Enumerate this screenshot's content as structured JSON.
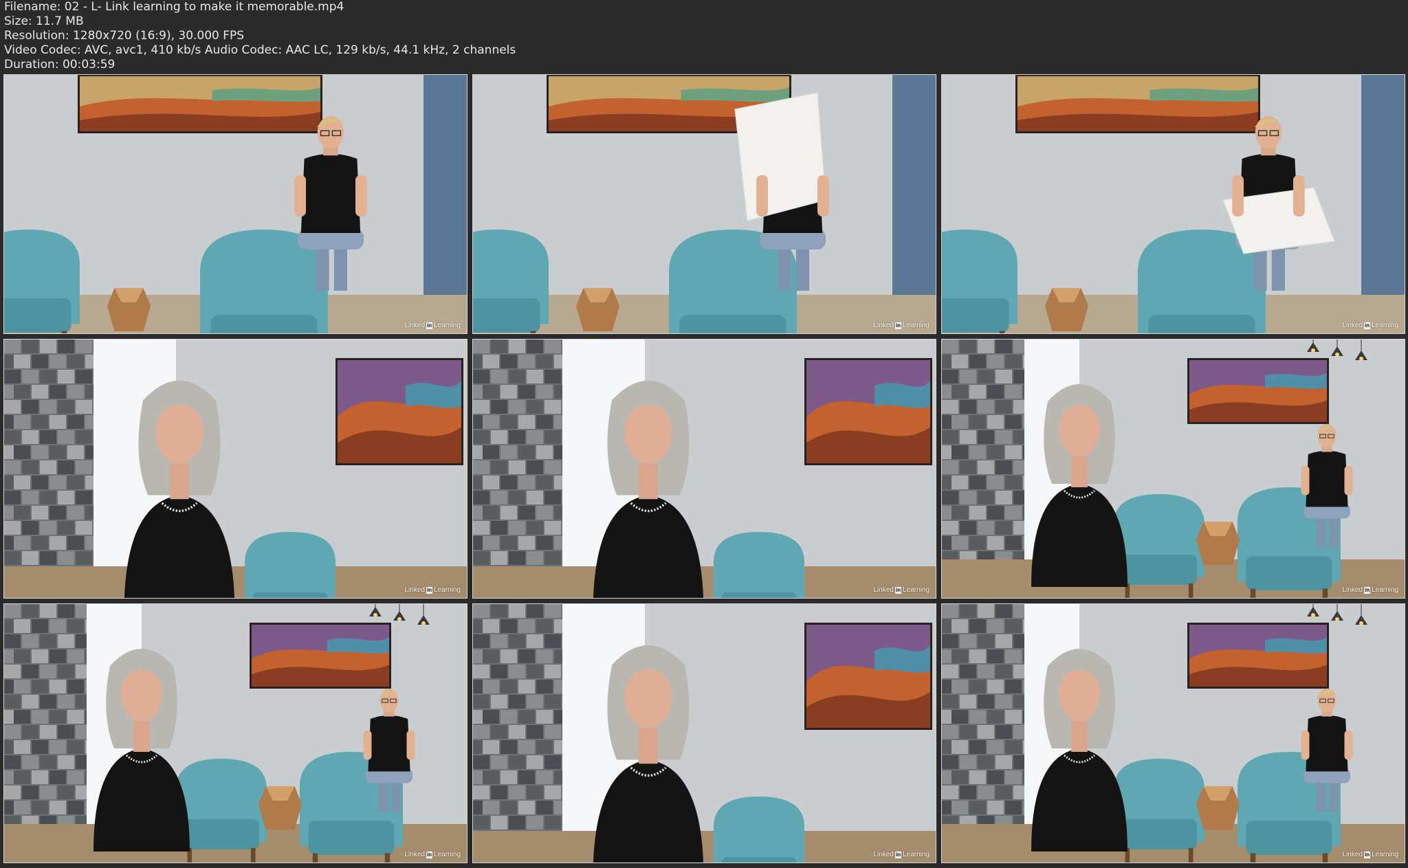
{
  "file_info": {
    "filename_label": "Filename:",
    "filename": "02 - L- Link learning to make it memorable.mp4",
    "size_label": "Size:",
    "size": "11.7 MB",
    "resolution_label": "Resolution:",
    "resolution": "1280x720 (16:9), 30.000 FPS",
    "video_codec_label": "Video Codec:",
    "video_codec": "AVC, avc1, 410 kb/s",
    "audio_codec_label": "Audio Codec:",
    "audio_codec": "AAC LC, 129 kb/s, 44.1 kHz, 2 channels",
    "duration_label": "Duration:",
    "duration": "00:03:59"
  },
  "watermark": {
    "prefix": "Linked",
    "badge": "in",
    "suffix": "Learning"
  },
  "colors": {
    "background": "#2b2b2b",
    "text": "#e8e8e8",
    "wall": "#c9cdd0",
    "chair": "#5fa7b3",
    "shirt": "#141414",
    "hair": "#b9b7b2"
  },
  "thumbnails": [
    {
      "scene": "man-seated-gesturing",
      "icon": "video-frame-icon"
    },
    {
      "scene": "man-seated-holding-board",
      "icon": "video-frame-icon"
    },
    {
      "scene": "man-seated-drawing-on-board",
      "icon": "video-frame-icon"
    },
    {
      "scene": "woman-presenter-closeup",
      "icon": "video-frame-icon"
    },
    {
      "scene": "woman-presenter-closeup",
      "icon": "video-frame-icon"
    },
    {
      "scene": "woman-presenter-wide-man-seated",
      "icon": "video-frame-icon"
    },
    {
      "scene": "woman-presenter-wide-man-seated",
      "icon": "video-frame-icon"
    },
    {
      "scene": "woman-presenter-closeup-gesturing",
      "icon": "video-frame-icon"
    },
    {
      "scene": "woman-presenter-wide-man-seated",
      "icon": "video-frame-icon"
    }
  ]
}
